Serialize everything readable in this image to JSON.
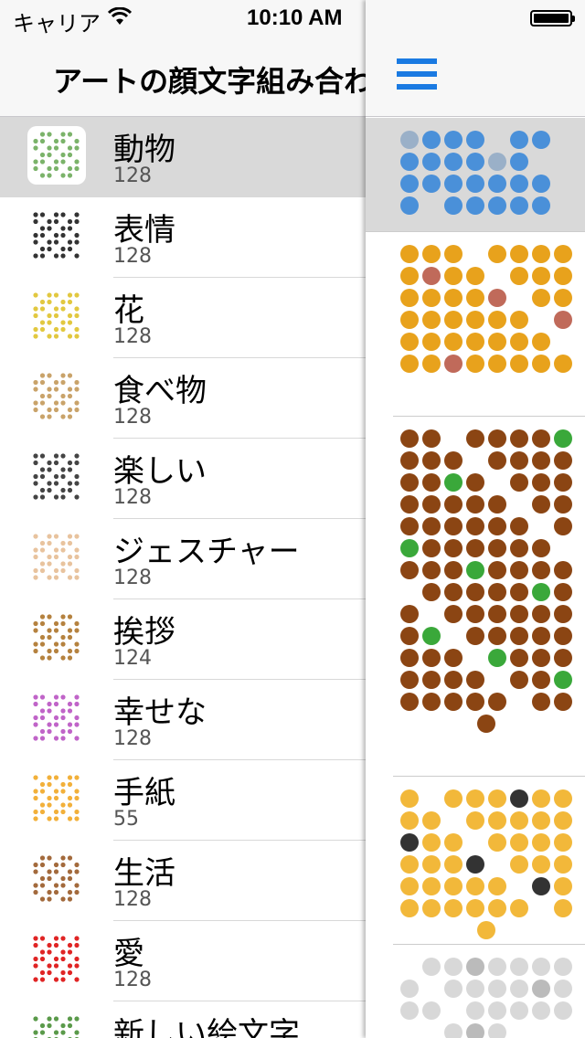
{
  "status_bar": {
    "carrier": "キャリア",
    "time": "10:10 AM"
  },
  "nav": {
    "title": "アートの顔文字組み合わせ"
  },
  "categories": [
    {
      "name": "動物",
      "count": "128",
      "icon": "animal-art-icon",
      "color": "#7bb36a"
    },
    {
      "name": "表情",
      "count": "128",
      "icon": "face-art-icon",
      "color": "#333333"
    },
    {
      "name": "花",
      "count": "128",
      "icon": "flower-art-icon",
      "color": "#e2c840"
    },
    {
      "name": "食べ物",
      "count": "128",
      "icon": "food-art-icon",
      "color": "#c9a36a"
    },
    {
      "name": "楽しい",
      "count": "128",
      "icon": "fun-art-icon",
      "color": "#444444"
    },
    {
      "name": "ジェスチャー",
      "count": "128",
      "icon": "gesture-art-icon",
      "color": "#e8c39e"
    },
    {
      "name": "挨拶",
      "count": "124",
      "icon": "greeting-art-icon",
      "color": "#b5823f"
    },
    {
      "name": "幸せな",
      "count": "128",
      "icon": "happy-art-icon",
      "color": "#c064c8"
    },
    {
      "name": "手紙",
      "count": "55",
      "icon": "letter-art-icon",
      "color": "#f2b03a"
    },
    {
      "name": "生活",
      "count": "128",
      "icon": "life-art-icon",
      "color": "#a36a3c"
    },
    {
      "name": "愛",
      "count": "128",
      "icon": "love-art-icon",
      "color": "#e02424"
    },
    {
      "name": "新しい絵文字",
      "count": "",
      "icon": "new-emoji-art-icon",
      "color": "#5a9a4a"
    }
  ],
  "previews": [
    {
      "name": "whale-art",
      "main": "#4a90d9",
      "accent": "#9ab0c8"
    },
    {
      "name": "honey-pot-art",
      "main": "#e8a21c",
      "accent": "#c06a5a"
    },
    {
      "name": "chestnut-bunny-art",
      "main": "#8b4513",
      "accent": "#3aa83a"
    },
    {
      "name": "tiger-art",
      "main": "#f2b83a",
      "accent": "#333333"
    },
    {
      "name": "rabbit-art",
      "main": "#d8d8d8",
      "accent": "#bbbbbb"
    }
  ]
}
